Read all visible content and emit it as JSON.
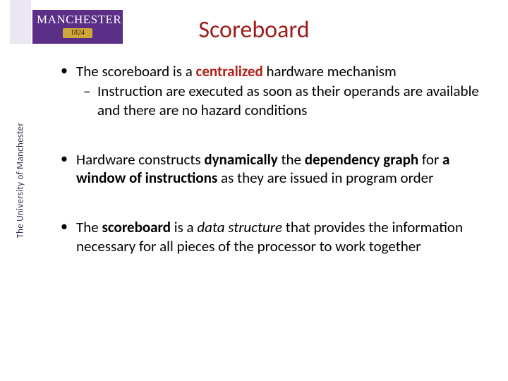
{
  "logo": {
    "name_html": "MANCHESTER",
    "year": "1824",
    "side_text": "The University of Manchester"
  },
  "title": "Scoreboard",
  "bullets": [
    {
      "pre1": "The scoreboard is a ",
      "kw1": "centralized",
      "post1": " hardware mechanism",
      "sub": "Instruction are executed as soon as their operands are available and there are no hazard conditions"
    },
    {
      "pre1": "Hardware constructs ",
      "kw1": "dynamically",
      "mid1": " the ",
      "kw2": "dependency graph",
      "mid2": " for ",
      "kw3": "a window of instructions",
      "post1": " as they are issued in program order"
    },
    {
      "pre1": "The ",
      "kw1": "scoreboard",
      "mid1": " is a ",
      "ital1": "data structure",
      "post1": " that provides the information necessary for all pieces of the processor to work together"
    }
  ]
}
